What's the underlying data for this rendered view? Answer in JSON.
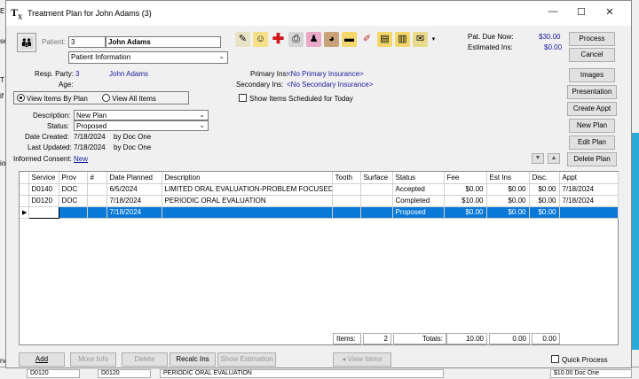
{
  "window": {
    "title": "Treatment Plan for John Adams (3)",
    "minimize": "—",
    "maximize": "☐",
    "close": "✕"
  },
  "patient": {
    "label": "Patient:",
    "id": "3",
    "name": "John Adams",
    "info_select": "Patient Information"
  },
  "account": {
    "resp_label": "Resp. Party:",
    "resp_id": "3",
    "resp_name": "John Adams",
    "age_label": "Age:",
    "primary_label": "Primary Ins:",
    "primary_value": "<No Primary Insurance>",
    "secondary_label": "Secondary Ins:",
    "secondary_value": "<No Secondary Insurance>"
  },
  "due": {
    "pat_due_label": "Pat. Due Now:",
    "pat_due_value": "$30.00",
    "est_ins_label": "Estimated Ins:",
    "est_ins_value": "$0.00"
  },
  "view": {
    "by_plan": "View Items By Plan",
    "all_items": "View All Items",
    "show_scheduled": "Show Items Scheduled for Today"
  },
  "plan": {
    "description_label": "Description:",
    "description_value": "New Plan",
    "status_label": "Status:",
    "status_value": "Proposed",
    "created_label": "Date Created:",
    "created_value": "7/18/2024",
    "created_by": "by  Doc One",
    "updated_label": "Last Updated:",
    "updated_value": "7/18/2024",
    "updated_by": "by  Doc One",
    "consent_label": "Informed Consent:",
    "consent_link": "New"
  },
  "side_buttons": {
    "process": "Process",
    "cancel": "Cancel",
    "images": "Images",
    "presentation": "Presentation",
    "create_appt": "Create Appt",
    "new_plan": "New Plan",
    "edit_plan": "Edit Plan",
    "delete_plan": "Delete Plan"
  },
  "grid": {
    "columns": [
      "Service",
      "Prov",
      "#",
      "Date Planned",
      "Description",
      "Tooth",
      "Surface",
      "Status",
      "Fee",
      "Est Ins",
      "Disc.",
      "Appt"
    ],
    "rows": [
      {
        "service": "D0140",
        "prov": "DOC",
        "num": "",
        "date": "6/5/2024",
        "desc": "LIMITED ORAL EVALUATION-PROBLEM FOCUSED",
        "tooth": "",
        "surface": "",
        "status": "Accepted",
        "fee": "$0.00",
        "est": "$0.00",
        "disc": "$0.00",
        "appt": "7/18/2024"
      },
      {
        "service": "D0120",
        "prov": "DOC",
        "num": "",
        "date": "7/18/2024",
        "desc": "PERIODIC ORAL EVALUATION",
        "tooth": "",
        "surface": "",
        "status": "Completed",
        "fee": "$10.00",
        "est": "$0.00",
        "disc": "$0.00",
        "appt": "7/18/2024"
      },
      {
        "service": "",
        "prov": "",
        "num": "",
        "date": "7/18/2024",
        "desc": "",
        "tooth": "",
        "surface": "",
        "status": "Proposed",
        "fee": "$0.00",
        "est": "$0.00",
        "disc": "$0.00",
        "appt": ""
      }
    ]
  },
  "totals": {
    "items_label": "Items:",
    "items_value": "2",
    "totals_label": "Totals:",
    "fee": "10.00",
    "est": "0.00",
    "disc": "0.00"
  },
  "bottom_buttons": {
    "add": "Add",
    "more_info": "More Info",
    "delete": "Delete",
    "recalc": "Recalc Ins",
    "show_estimation": "Show Estimation",
    "view_items": "View Items",
    "quick_process": "Quick Process"
  },
  "background": {
    "bottom_service": "D0120",
    "bottom_prov": "D0120",
    "bottom_desc": "PERIODIC ORAL EVALUATION",
    "bottom_fee": "$10.00  Doc One",
    "left_letters": [
      "E",
      "se",
      "T",
      "if",
      "io",
      "rv"
    ]
  },
  "colors": {
    "selection": "#0a78d7",
    "link": "#1a1a9c",
    "accent_blue": "#29a9d8"
  }
}
